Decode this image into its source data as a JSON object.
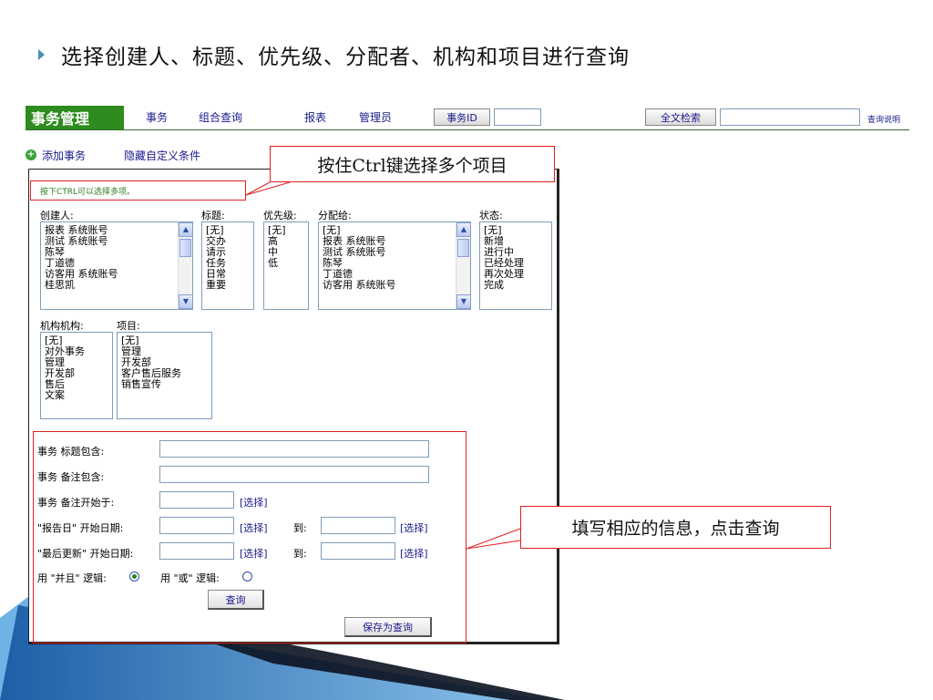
{
  "slide": {
    "title": "选择创建人、标题、优先级、分配者、机构和项目进行查询"
  },
  "nav": {
    "brand": "事务管理",
    "links": [
      "事务",
      "组合查询",
      "报表",
      "管理员"
    ],
    "id_button": "事务ID",
    "fulltext_button": "全文检索",
    "help_link": "查询说明"
  },
  "toolbar": {
    "add": "添加事务",
    "hide_custom": "隐藏自定义条件"
  },
  "panel": {
    "hint": "按下CTRL可以选择多项。",
    "creator_label": "创建人:",
    "creator_items": [
      "报表  系统账号",
      "测试  系统账号",
      "陈琴",
      "丁道德",
      "访客用  系统账号",
      "桂思凯"
    ],
    "title_label": "标题:",
    "title_items": [
      "[无]",
      "交办",
      "请示",
      "任务",
      "日常",
      "重要"
    ],
    "priority_label": "优先级:",
    "priority_items": [
      "[无]",
      "高",
      "中",
      "低"
    ],
    "assign_label": "分配给:",
    "assign_items": [
      "[无]",
      "报表  系统账号",
      "测试  系统账号",
      "陈琴",
      "丁道德",
      "访客用  系统账号"
    ],
    "status_label": "状态:",
    "status_items": [
      "[无]",
      "新增",
      "进行中",
      "已经处理",
      "再次处理",
      "完成"
    ],
    "org_label": "机构机构:",
    "org_items": [
      "[无]",
      "对外事务",
      "管理",
      "开发部",
      "售后",
      "文案"
    ],
    "project_label": "项目:",
    "project_items": [
      "[无]",
      "管理",
      "开发部",
      "客户售后服务",
      "销售宣传"
    ],
    "title_contains": "事务  标题包含:",
    "note_contains": "事务  备注包含:",
    "note_start": "事务  备注开始于:",
    "report_date": "\"报告日\" 开始日期:",
    "update_date": "\"最后更新\" 开始日期:",
    "to": "到:",
    "pick": "[选择]",
    "and_logic": "用 \"并且\" 逻辑:",
    "or_logic": "用 \"或\" 逻辑:",
    "query_button": "查询",
    "save_button": "保存为查询"
  },
  "callouts": {
    "ctrl": "按住Ctrl键选择多个项目",
    "fill": "填写相应的信息，点击查询"
  },
  "colors": {
    "brand_green": "#2e8b1e",
    "link_blue": "#1a1a8c",
    "annotation_red": "#e02020",
    "deco_blue": "#2f7fc0"
  }
}
